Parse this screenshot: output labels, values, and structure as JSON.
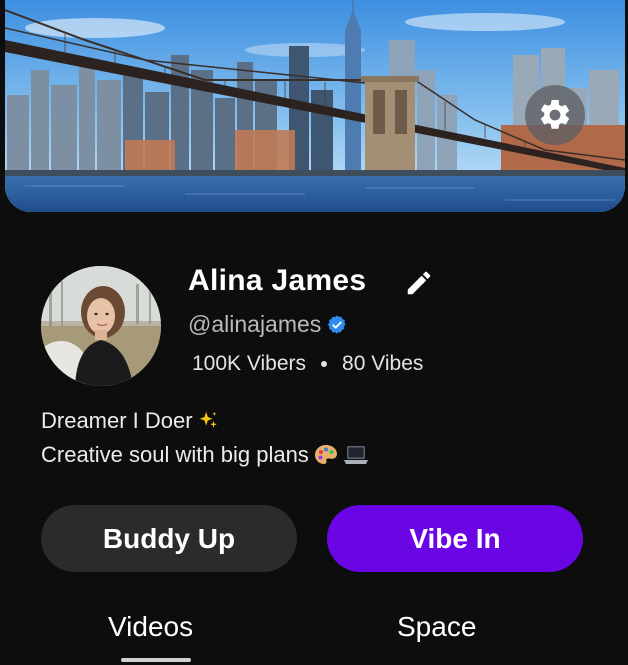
{
  "profile": {
    "name": "Alina James",
    "handle": "@alinajames",
    "verified": true,
    "stats": {
      "vibers": "100K Vibers",
      "vibes": "80 Vibes"
    },
    "bio": {
      "line1": "Dreamer I Doer",
      "line2": "Creative soul with big plans"
    }
  },
  "actions": {
    "buddy_up": "Buddy Up",
    "vibe_in": "Vibe In"
  },
  "tabs": [
    {
      "label": "Videos",
      "active": true
    },
    {
      "label": "Space",
      "active": false
    }
  ],
  "icons": {
    "settings": "gear-icon",
    "edit": "pencil-icon",
    "verified": "verified-badge-icon",
    "sparkles": "sparkles-emoji",
    "palette": "palette-emoji",
    "laptop": "laptop-emoji"
  },
  "colors": {
    "background": "#0d0d0e",
    "primary_button": "#6a06e3",
    "secondary_button": "#2b2b2e",
    "verified": "#2d8cf0"
  }
}
